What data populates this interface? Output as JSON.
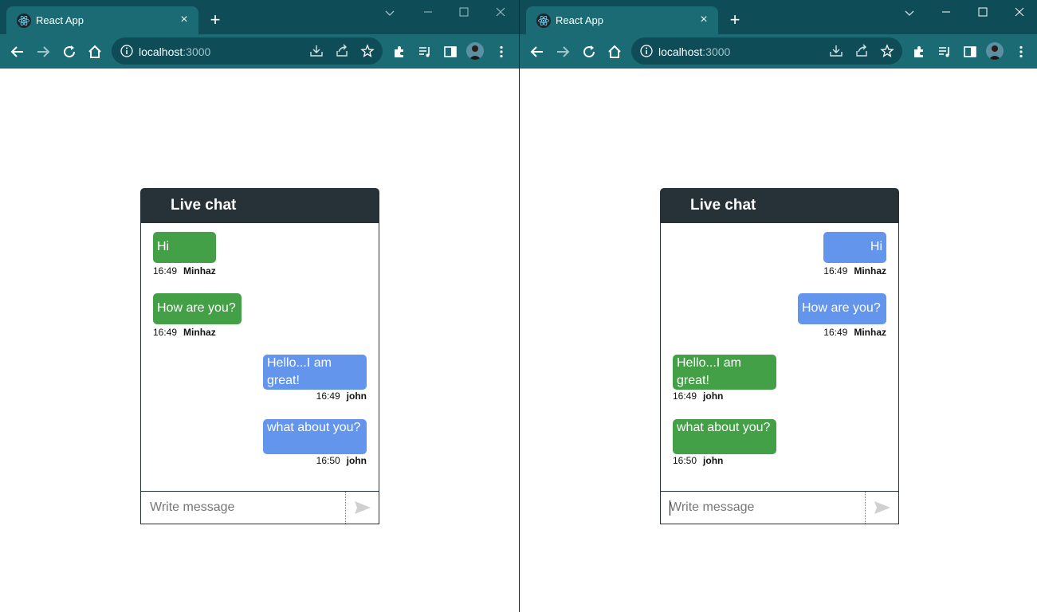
{
  "browser": {
    "tab_title": "React App",
    "tab_close": "×",
    "new_tab": "+",
    "url_host": "localhost",
    "url_port": ":3000",
    "colors": {
      "titlebar": "#0e4c57",
      "toolbar": "#1b6b74",
      "omnibox": "#0e4c57"
    }
  },
  "left_window": {
    "chat": {
      "title": "Live chat",
      "input_placeholder": "Write message",
      "messages": [
        {
          "text": "Hi",
          "time": "16:49",
          "author": "Minhaz",
          "color": "green",
          "side": "left"
        },
        {
          "text": "How are you?",
          "time": "16:49",
          "author": "Minhaz",
          "color": "green",
          "side": "left"
        },
        {
          "text": "Hello...I am great!",
          "time": "16:49",
          "author": "john",
          "color": "blue",
          "side": "right"
        },
        {
          "text": "what about you?",
          "time": "16:50",
          "author": "john",
          "color": "blue",
          "side": "right"
        }
      ]
    }
  },
  "right_window": {
    "chat": {
      "title": "Live chat",
      "input_placeholder": "Write message",
      "messages": [
        {
          "text": "Hi",
          "time": "16:49",
          "author": "Minhaz",
          "color": "blue",
          "side": "right"
        },
        {
          "text": "How are you?",
          "time": "16:49",
          "author": "Minhaz",
          "color": "blue",
          "side": "right"
        },
        {
          "text": "Hello...I am great!",
          "time": "16:49",
          "author": "john",
          "color": "green",
          "side": "left"
        },
        {
          "text": "what about you?",
          "time": "16:50",
          "author": "john",
          "color": "green",
          "side": "left"
        }
      ]
    }
  },
  "colors": {
    "chat_header": "#263238",
    "own_bubble": "#6495ed",
    "other_bubble": "#43a047"
  }
}
